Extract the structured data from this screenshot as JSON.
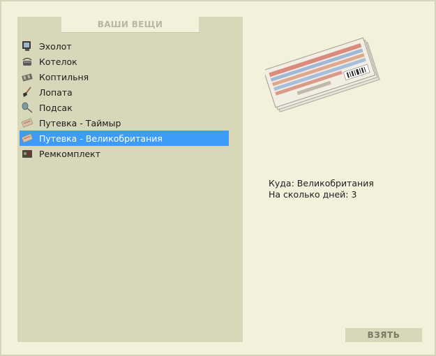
{
  "inventory": {
    "header": "ВАШИ ВЕЩИ",
    "items": [
      {
        "label": "Эхолот",
        "icon": "echo-sounder-icon"
      },
      {
        "label": "Котелок",
        "icon": "pot-icon"
      },
      {
        "label": "Коптильня",
        "icon": "smokehouse-icon"
      },
      {
        "label": "Лопата",
        "icon": "shovel-icon"
      },
      {
        "label": "Подсак",
        "icon": "landing-net-icon"
      },
      {
        "label": "Путевка - Таймыр",
        "icon": "ticket-icon"
      },
      {
        "label": "Путевка - Великобритания",
        "icon": "ticket-icon"
      },
      {
        "label": "Ремкомплект",
        "icon": "repair-kit-icon"
      }
    ],
    "selected_index": 6
  },
  "details": {
    "line1": "Куда: Великобритания",
    "line2": "На сколько дней: 3"
  },
  "actions": {
    "take_label": "ВЗЯТЬ"
  },
  "colors": {
    "background": "#f3f1dc",
    "panel": "#d9d7b9",
    "selection": "#3d9cf8"
  }
}
